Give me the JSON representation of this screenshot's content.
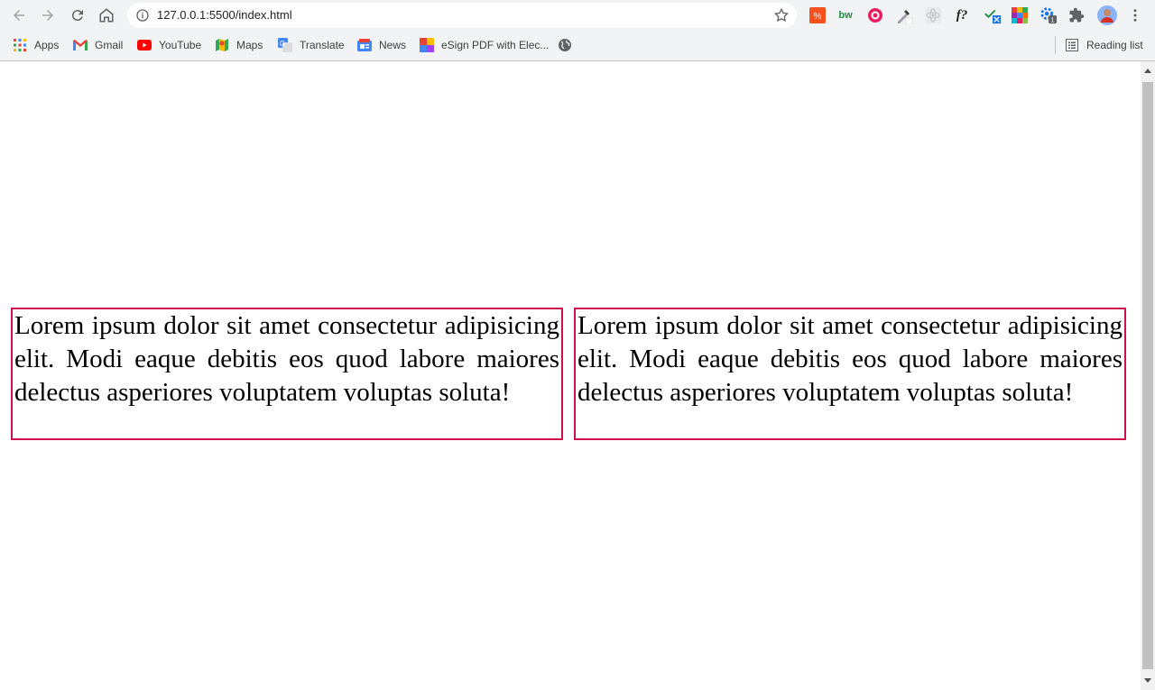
{
  "browser": {
    "url": "127.0.0.1:5500/index.html",
    "reading_list_label": "Reading list",
    "bookmarks": [
      {
        "label": "Apps",
        "icon": "apps-grid-icon"
      },
      {
        "label": "Gmail",
        "icon": "gmail-icon"
      },
      {
        "label": "YouTube",
        "icon": "youtube-icon"
      },
      {
        "label": "Maps",
        "icon": "maps-icon"
      },
      {
        "label": "Translate",
        "icon": "translate-icon"
      },
      {
        "label": "News",
        "icon": "news-icon"
      },
      {
        "label": "eSign PDF with Elec...",
        "icon": "esign-icon"
      }
    ],
    "extensions_text": {
      "bw": "bw",
      "fq": "f?"
    },
    "colors": {
      "accent_border": "#d0104c"
    }
  },
  "page": {
    "boxes": [
      {
        "text": "Lorem ipsum dolor sit amet consectetur adipisicing elit. Modi eaque debitis eos quod labore maiores delectus asperiores voluptatem voluptas soluta!"
      },
      {
        "text": "Lorem ipsum dolor sit amet consectetur adipisicing elit. Modi eaque debitis eos quod labore maiores delectus asperiores voluptatem voluptas soluta!"
      }
    ]
  }
}
